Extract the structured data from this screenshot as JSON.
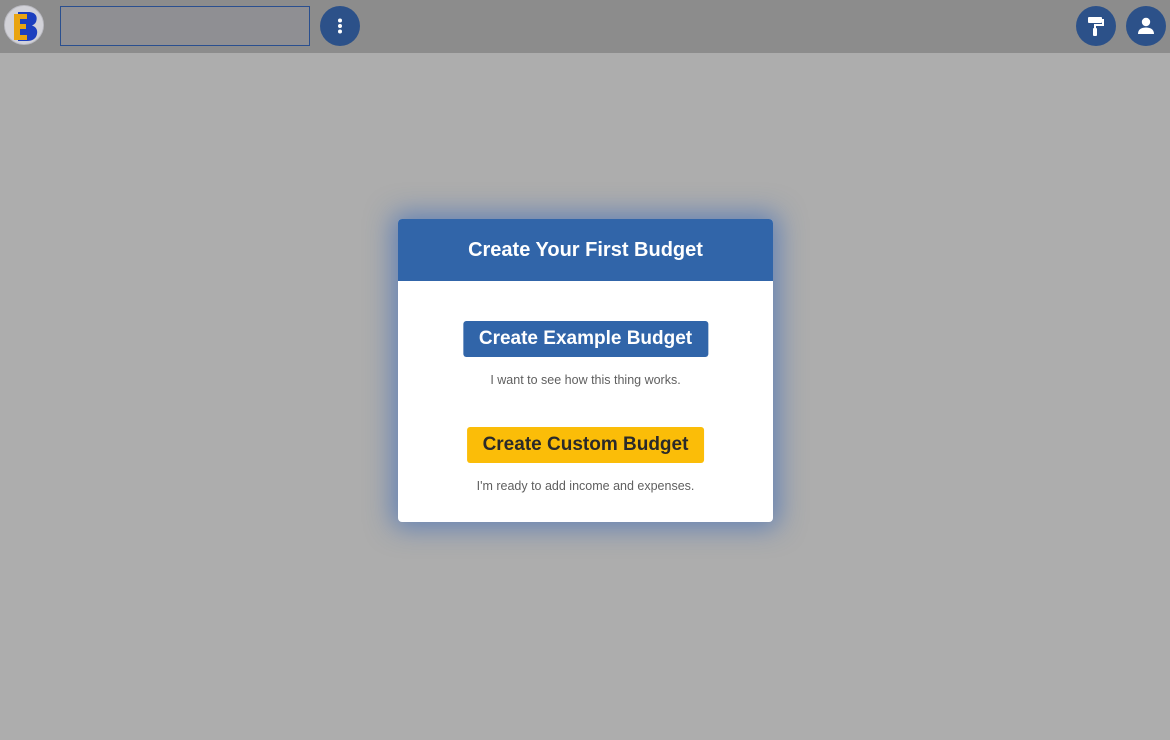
{
  "header": {
    "logo_icon": "eb-logo-icon",
    "search": {
      "value": "",
      "placeholder": ""
    },
    "menu_icon": "vertical-dots-icon",
    "paint_icon": "paint-roller-icon",
    "user_icon": "user-icon"
  },
  "dialog": {
    "title": "Create Your First Budget",
    "example_button_label": "Create Example Budget",
    "example_caption": "I want to see how this thing works.",
    "custom_button_label": "Create Custom Budget",
    "custom_caption": "I'm ready to add income and expenses."
  },
  "colors": {
    "primary": "#3165a9",
    "accent": "#fbbd08",
    "topbar": "#8c8c8c",
    "overlay": "#adadad"
  }
}
